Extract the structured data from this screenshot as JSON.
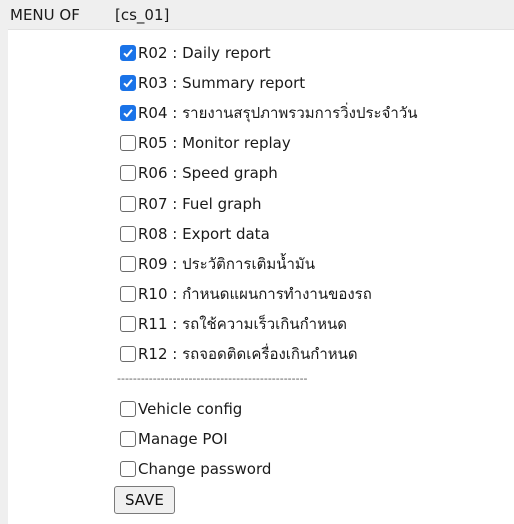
{
  "header": {
    "menu_label": "MENU OF",
    "user_code": "[cs_01]"
  },
  "accent_color": "#1a73e8",
  "reports": [
    {
      "label": "R02 : Daily report",
      "checked": true
    },
    {
      "label": "R03 : Summary report",
      "checked": true
    },
    {
      "label": "R04 : รายงานสรุปภาพรวมการวิ่งประจำวัน",
      "checked": true
    },
    {
      "label": "R05 : Monitor replay",
      "checked": false
    },
    {
      "label": "R06 : Speed graph",
      "checked": false
    },
    {
      "label": "R07 : Fuel graph",
      "checked": false
    },
    {
      "label": "R08 : Export data",
      "checked": false
    },
    {
      "label": "R09 : ประวัติการเติมน้ำมัน",
      "checked": false
    },
    {
      "label": "R10 : กำหนดแผนการทำงานของรถ",
      "checked": false
    },
    {
      "label": "R11 : รถใช้ความเร็วเกินกำหนด",
      "checked": false
    },
    {
      "label": "R12 : รถจอดติดเครื่องเกินกำหนด",
      "checked": false
    }
  ],
  "divider": "------------------------------------------------",
  "settings": [
    {
      "label": "Vehicle config",
      "checked": false
    },
    {
      "label": "Manage POI",
      "checked": false
    },
    {
      "label": "Change password",
      "checked": false
    }
  ],
  "save_label": "SAVE"
}
